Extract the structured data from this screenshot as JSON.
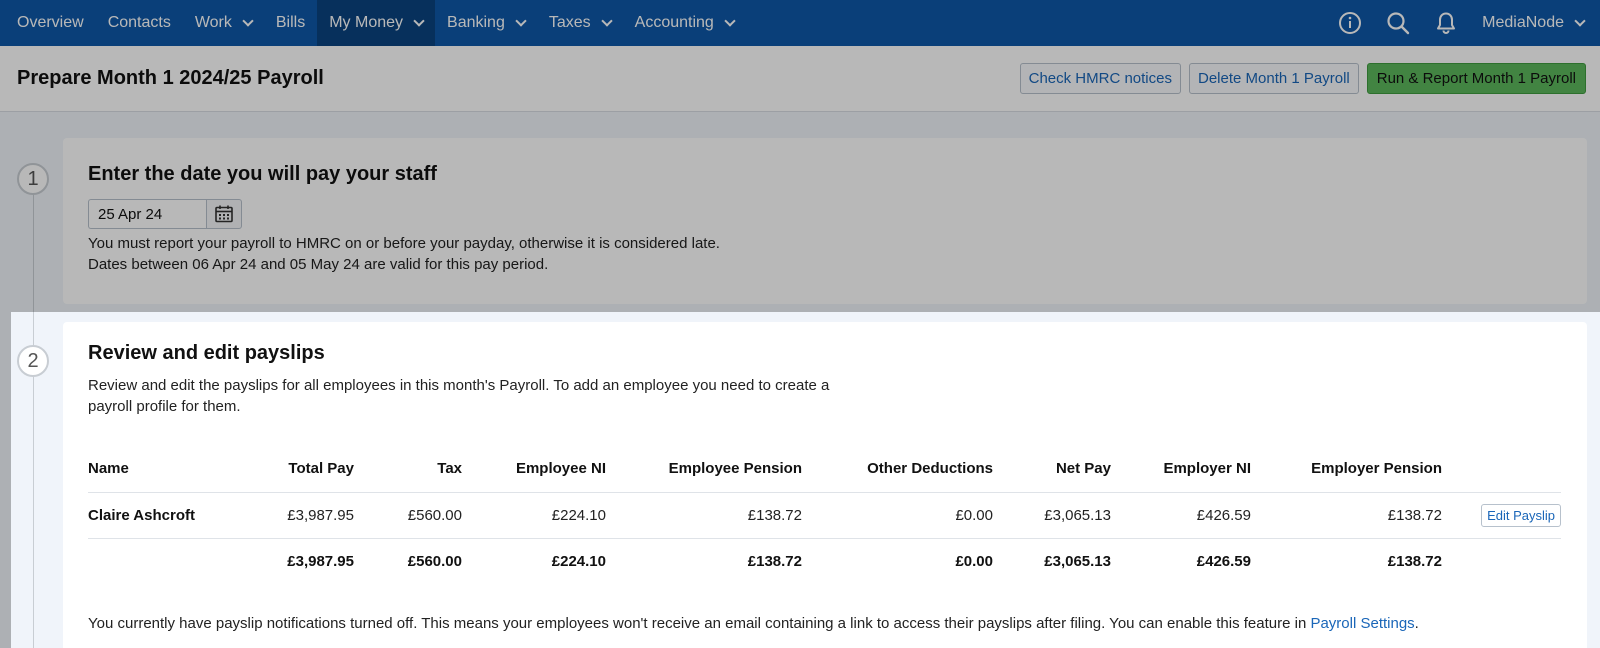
{
  "nav": {
    "items": [
      {
        "label": "Overview",
        "dropdown": false
      },
      {
        "label": "Contacts",
        "dropdown": false
      },
      {
        "label": "Work",
        "dropdown": true
      },
      {
        "label": "Bills",
        "dropdown": false
      },
      {
        "label": "My Money",
        "dropdown": true,
        "active": true
      },
      {
        "label": "Banking",
        "dropdown": true
      },
      {
        "label": "Taxes",
        "dropdown": true
      },
      {
        "label": "Accounting",
        "dropdown": true
      }
    ],
    "user": "MediaNode",
    "icons": [
      "info-icon",
      "search-icon",
      "bell-icon"
    ]
  },
  "header": {
    "title": "Prepare Month 1 2024/25 Payroll",
    "check_hmrc": "Check HMRC notices",
    "delete_payroll": "Delete Month 1 Payroll",
    "run_report": "Run & Report Month 1 Payroll"
  },
  "step1": {
    "number": "1",
    "heading": "Enter the date you will pay your staff",
    "date_value": "25 Apr 24",
    "line1": "You must report your payroll to HMRC on or before your payday, otherwise it is considered late.",
    "line2": "Dates between 06 Apr 24 and 05 May 24 are valid for this pay period."
  },
  "step2": {
    "number": "2",
    "heading": "Review and edit payslips",
    "desc_line1": "Review and edit the payslips for all employees in this month's Payroll. To add an employee you need to create a",
    "desc_line2": "payroll profile for them.",
    "columns": [
      "Name",
      "Total Pay",
      "Tax",
      "Employee NI",
      "Employee Pension",
      "Other Deductions",
      "Net Pay",
      "Employer NI",
      "Employer Pension"
    ],
    "rows": [
      {
        "name": "Claire Ashcroft",
        "total_pay": "£3,987.95",
        "tax": "£560.00",
        "employee_ni": "£224.10",
        "employee_pension": "£138.72",
        "other_deductions": "£0.00",
        "net_pay": "£3,065.13",
        "employer_ni": "£426.59",
        "employer_pension": "£138.72",
        "action": "Edit Payslip"
      }
    ],
    "totals": {
      "total_pay": "£3,987.95",
      "tax": "£560.00",
      "employee_ni": "£224.10",
      "employee_pension": "£138.72",
      "other_deductions": "£0.00",
      "net_pay": "£3,065.13",
      "employer_ni": "£426.59",
      "employer_pension": "£138.72"
    },
    "notice": "You currently have payslip notifications turned off. This means your employees won't receive an email containing a link to access their payslips after filing. You can enable this feature in ",
    "notice_link": "Payroll Settings",
    "notice_end": "."
  },
  "colors": {
    "nav_bg": "#0e58a8",
    "nav_active": "#0a4380",
    "link": "#1a66b8",
    "primary_green": "#5cb85c"
  }
}
